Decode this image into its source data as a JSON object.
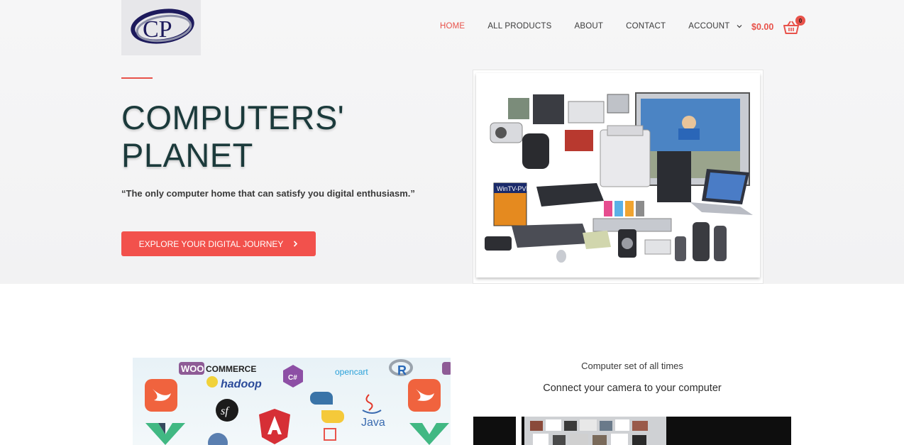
{
  "brand": {
    "logo_letters": "CP"
  },
  "nav": {
    "items": [
      {
        "label": "HOME",
        "active": true
      },
      {
        "label": "ALL PRODUCTS",
        "active": false
      },
      {
        "label": "ABOUT",
        "active": false
      },
      {
        "label": "CONTACT",
        "active": false
      },
      {
        "label": "ACCOUNT",
        "active": false,
        "has_dropdown": true
      }
    ],
    "dropdown_icon": "chevron-down-icon"
  },
  "cart": {
    "total": "$0.00",
    "count": "0",
    "icon": "shopping-basket-icon"
  },
  "hero": {
    "title_line1": "COMPUTERS'",
    "title_line2": "PLANET",
    "quote": "“The only computer home that can satisfy you digital enthusiasm.”",
    "cta_label": "EXPLORE YOUR DIGITAL JOURNEY",
    "cta_icon": "chevron-right-icon",
    "image_label": "WinTV-PVR"
  },
  "section2": {
    "tech_labels": {
      "woo": "WOO",
      "commerce": "COMMERCE",
      "hadoop": "hadoop",
      "opencart": "opencart",
      "r": "R",
      "csharp": "C#",
      "sf": "sf",
      "java": "Java"
    },
    "caption": "Computer set of all times",
    "heading": "Connect your camera to your computer"
  },
  "colors": {
    "accent": "#e8524a",
    "cta": "#f2514c",
    "title": "#1b3a3b",
    "logo_navy": "#1d1a5c"
  }
}
